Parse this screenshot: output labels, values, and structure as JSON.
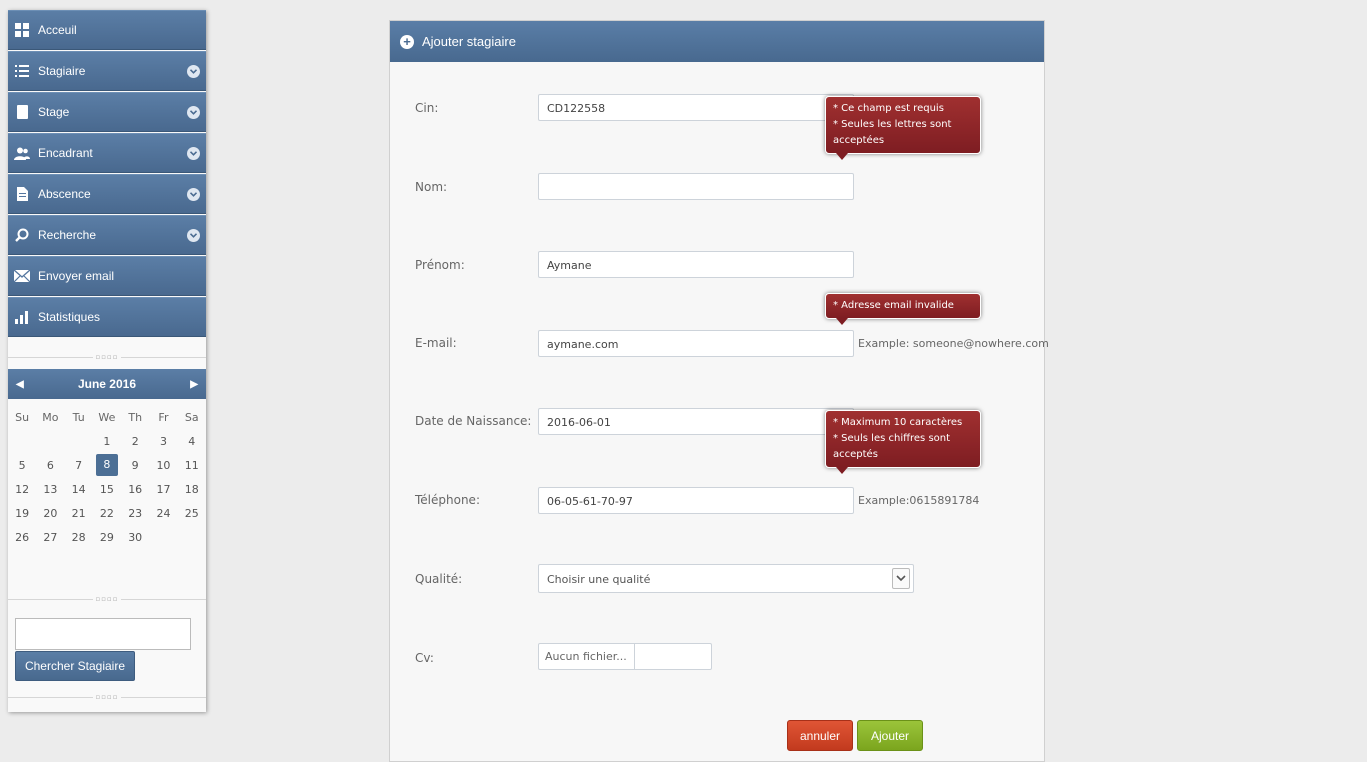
{
  "sidebar": {
    "menu": [
      {
        "label": "Acceuil",
        "icon": "dashboard-icon",
        "has_chevron": false
      },
      {
        "label": "Stagiaire",
        "icon": "list-icon",
        "has_chevron": true
      },
      {
        "label": "Stage",
        "icon": "tablet-icon",
        "has_chevron": true
      },
      {
        "label": "Encadrant",
        "icon": "users-icon",
        "has_chevron": true
      },
      {
        "label": "Abscence",
        "icon": "file-icon",
        "has_chevron": true
      },
      {
        "label": "Recherche",
        "icon": "search-icon",
        "has_chevron": true
      },
      {
        "label": "Envoyer email",
        "icon": "envelope-icon",
        "has_chevron": false
      },
      {
        "label": "Statistiques",
        "icon": "bar-chart-icon",
        "has_chevron": false
      }
    ],
    "calendar": {
      "month_label": "June 2016",
      "weekdays": [
        "Su",
        "Mo",
        "Tu",
        "We",
        "Th",
        "Fr",
        "Sa"
      ],
      "weeks": [
        [
          "",
          "",
          "",
          "1",
          "2",
          "3",
          "4"
        ],
        [
          "5",
          "6",
          "7",
          "8",
          "9",
          "10",
          "11"
        ],
        [
          "12",
          "13",
          "14",
          "15",
          "16",
          "17",
          "18"
        ],
        [
          "19",
          "20",
          "21",
          "22",
          "23",
          "24",
          "25"
        ],
        [
          "26",
          "27",
          "28",
          "29",
          "30",
          "",
          ""
        ]
      ],
      "selected_day": "8"
    },
    "search_button_label": "Chercher Stagiaire",
    "search_input_value": ""
  },
  "form": {
    "title": "Ajouter stagiaire",
    "fields": {
      "cin": {
        "label": "Cin:",
        "value": "CD122558"
      },
      "nom": {
        "label": "Nom:",
        "value": ""
      },
      "prenom": {
        "label": "Prénom:",
        "value": "Aymane"
      },
      "email": {
        "label": "E-mail:",
        "value": "aymane.com",
        "hint": "Example: someone@nowhere.com"
      },
      "date_naissance": {
        "label": "Date de Naissance:",
        "value": "2016-06-01"
      },
      "telephone": {
        "label": "Téléphone:",
        "value": "06-05-61-70-97",
        "hint": "Example:0615891784"
      },
      "qualite": {
        "label": "Qualité:",
        "selected": "Choisir une qualité"
      },
      "cv": {
        "label": "Cv:",
        "file_text": "Aucun fichier..."
      }
    },
    "errors": {
      "nom": [
        "* Ce champ est requis",
        "* Seules les lettres sont acceptées"
      ],
      "email": [
        "* Adresse email invalide"
      ],
      "telephone": [
        "* Maximum 10 caractères",
        "* Seuls les chiffres sont acceptés"
      ]
    },
    "buttons": {
      "cancel": "annuler",
      "submit": "Ajouter"
    }
  },
  "colors": {
    "sidebar_blue": "#4f7199",
    "error_red": "#8b2328",
    "cancel_red": "#d2472a",
    "submit_green": "#8ab52a"
  }
}
